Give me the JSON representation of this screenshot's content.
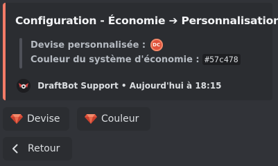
{
  "embed": {
    "title": "Configuration - Économie ➔ Personnalisation",
    "accent_color": "#f47b67",
    "fields": [
      {
        "label": "Devise personnalisée :",
        "icon": "dc-coin-icon"
      },
      {
        "label": "Couleur du système d'économie :",
        "value": "#57c478"
      }
    ],
    "footer": {
      "author": "DraftBot Support",
      "separator": "•",
      "time": "Aujourd'hui à 18:15"
    }
  },
  "buttons": [
    {
      "label": "Devise",
      "icon": "gem-icon"
    },
    {
      "label": "Couleur",
      "icon": "gem-icon"
    },
    {
      "label": "Retour",
      "icon": "chevron-left-icon"
    }
  ]
}
